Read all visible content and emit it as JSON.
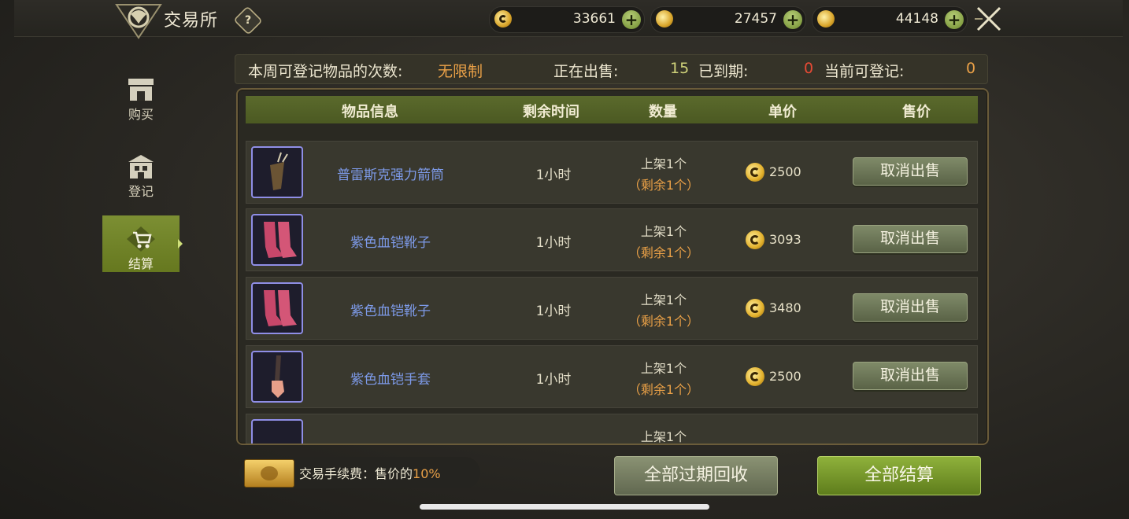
{
  "header": {
    "title": "交易所",
    "help_icon": "?",
    "currencies": [
      {
        "icon": "gold-coin-icon",
        "value": "33661"
      },
      {
        "icon": "bound-gold-icon",
        "value": "27457"
      },
      {
        "icon": "silver-coin-icon",
        "value": "44148"
      }
    ],
    "plus": "+"
  },
  "sidebar": {
    "items": [
      {
        "label": "购买",
        "icon": "shop-icon",
        "active": false
      },
      {
        "label": "登记",
        "icon": "register-icon",
        "active": false
      },
      {
        "label": "结算",
        "icon": "cart-icon",
        "active": true
      }
    ]
  },
  "stats": {
    "weekly_label": "本周可登记物品的次数:",
    "weekly_value": "无限制",
    "selling_label": "正在出售:",
    "selling_value": "15",
    "expired_label": "已到期:",
    "expired_value": "0",
    "available_label": "当前可登记:",
    "available_value": "0"
  },
  "table": {
    "headers": [
      "物品信息",
      "剩余时间",
      "数量",
      "单价",
      "售价"
    ],
    "rows": [
      {
        "name": "普雷斯克强力箭筒",
        "time": "1小时",
        "qty": "上架1个",
        "remain": "（剩余1个）",
        "price": "2500",
        "action": "取消出售"
      },
      {
        "name": "紫色血铠靴子",
        "time": "1小时",
        "qty": "上架1个",
        "remain": "（剩余1个）",
        "price": "3093",
        "action": "取消出售"
      },
      {
        "name": "紫色血铠靴子",
        "time": "1小时",
        "qty": "上架1个",
        "remain": "（剩余1个）",
        "price": "3480",
        "action": "取消出售"
      },
      {
        "name": "紫色血铠手套",
        "time": "1小时",
        "qty": "上架1个",
        "remain": "（剩余1个）",
        "price": "2500",
        "action": "取消出售"
      },
      {
        "name": "",
        "time": "",
        "qty": "上架1个",
        "remain": "",
        "price": "",
        "action": ""
      }
    ]
  },
  "footer": {
    "fee_label": "交易手续费：售价的",
    "fee_value": "10%",
    "recycle_button": "全部过期回收",
    "settle_button": "全部结算"
  },
  "colors": {
    "accent_green": "#7c8f33",
    "rarity_blue": "#7d9ae8",
    "orange": "#e9a047",
    "red": "#e64a35"
  }
}
